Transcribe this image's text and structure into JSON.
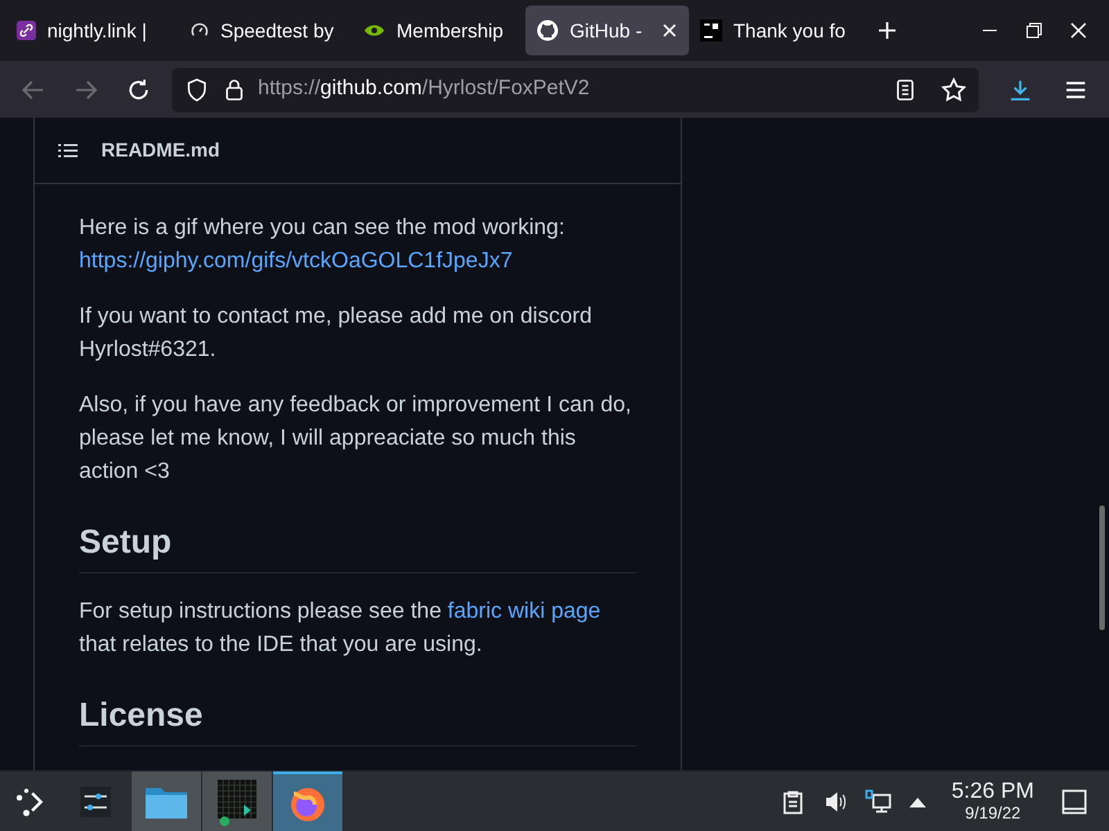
{
  "tabs": [
    {
      "title": "nightly.link |",
      "kind": "link",
      "selected": false
    },
    {
      "title": "Speedtest by",
      "kind": "gauge",
      "selected": false
    },
    {
      "title": "Membership",
      "kind": "nvidia",
      "selected": false
    },
    {
      "title": "GitHub -",
      "kind": "github",
      "selected": true
    },
    {
      "title": "Thank you fo",
      "kind": "jb",
      "selected": false
    }
  ],
  "address_bar": {
    "url_dim": "https://",
    "url_host": "github.com",
    "url_path": "/Hyrlost/FoxPetV2"
  },
  "readme": {
    "title": "README.md",
    "blocks": [
      {
        "kind": "paragraph",
        "parts": [
          {
            "text": "Here is a gif where you can see the mod working:"
          },
          {
            "kind": "break"
          },
          {
            "kind": "link",
            "text": "https://giphy.com/gifs/vtckOaGOLC1fJpeJx7"
          }
        ]
      },
      {
        "kind": "paragraph",
        "parts": [
          {
            "text": "If you want to contact me, please add me on discord Hyrlost#6321."
          }
        ]
      },
      {
        "kind": "paragraph",
        "parts": [
          {
            "text": "Also, if you have any feedback or improvement I can do, please let me know, I will appreaciate so much this action <3"
          }
        ]
      },
      {
        "kind": "heading",
        "text": "Setup"
      },
      {
        "kind": "paragraph",
        "parts": [
          {
            "text": "For setup instructions please see the "
          },
          {
            "kind": "link",
            "text": "fabric wiki page"
          },
          {
            "text": " that relates to the IDE that you are using."
          }
        ]
      },
      {
        "kind": "heading",
        "text": "License"
      }
    ]
  },
  "taskbar": {
    "apps": [
      {
        "kind": "settings",
        "selected": false
      },
      {
        "kind": "folder",
        "selected": true
      },
      {
        "kind": "grid",
        "selected": true
      },
      {
        "kind": "firefox",
        "selected": true
      }
    ],
    "time": "5:26 PM",
    "date": "9/19/22"
  }
}
